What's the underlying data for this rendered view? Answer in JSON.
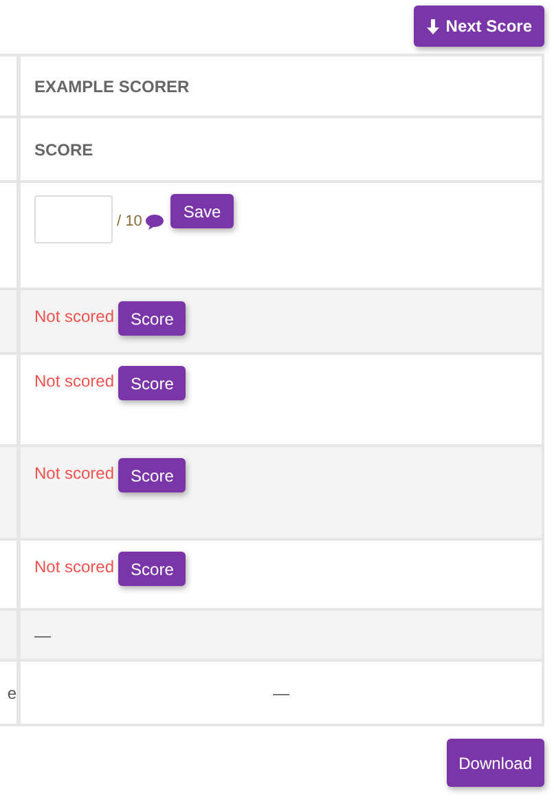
{
  "next_score_button": {
    "label": "Next Score"
  },
  "table": {
    "header": "EXAMPLE SCORER",
    "subheader": "SCORE",
    "rows": [
      {
        "kind": "input",
        "max": "/ 10",
        "action": "Save"
      },
      {
        "kind": "unscored",
        "status": "Not scored",
        "action": "Score"
      },
      {
        "kind": "unscored",
        "status": "Not scored",
        "action": "Score"
      },
      {
        "kind": "unscored",
        "status": "Not scored",
        "action": "Score"
      },
      {
        "kind": "unscored",
        "status": "Not scored",
        "action": "Score"
      },
      {
        "kind": "empty",
        "value": "—"
      },
      {
        "kind": "total",
        "label": "e",
        "value": "—"
      }
    ]
  },
  "download_button": {
    "label": "Download"
  }
}
